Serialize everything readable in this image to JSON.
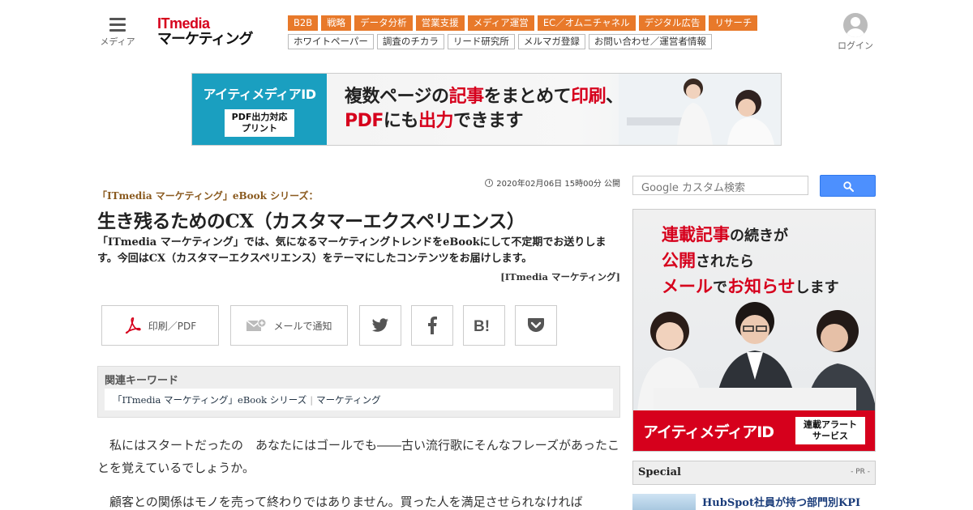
{
  "header": {
    "menu_label": "メディア",
    "logo_top": "ITmedia",
    "logo_bottom": "マーケティング",
    "nav_primary": [
      "B2B",
      "戦略",
      "データ分析",
      "営業支援",
      "メディア運営",
      "EC／オムニチャネル",
      "デジタル広告",
      "リサーチ"
    ],
    "nav_secondary": [
      "ホワイトペーパー",
      "調査のチカラ",
      "リード研究所",
      "メルマガ登録",
      "お問い合わせ／運営者情報"
    ],
    "login_label": "ログイン"
  },
  "banner": {
    "brand": "アイティメディアID",
    "badge_line1": "PDF出力対応",
    "badge_line2": "プリント",
    "line1_a": "複数ページの",
    "line1_b": "記事",
    "line1_c": "をまとめて",
    "line1_d": "印刷",
    "line1_e": "、",
    "line2_a": "PDF",
    "line2_b": "にも",
    "line2_c": "出力",
    "line2_d": "できます"
  },
  "article": {
    "date": "2020年02月06日 15時00分 公開",
    "series": "「ITmedia マーケティング」eBook シリーズ：",
    "title": "生き残るためのCX（カスタマーエクスペリエンス）",
    "lead": "「ITmedia マーケティング」では、気になるマーケティングトレンドをeBookにして不定期でお送りします。今回はCX（カスタマーエクスペリエンス）をテーマにしたコンテンツをお届けします。",
    "byline": "[ITmedia マーケティング]",
    "share_print": "印刷／PDF",
    "share_mail": "メールで通知",
    "keywords_title": "関連キーワード",
    "keywords": [
      "「ITmedia マーケティング」eBook シリーズ",
      "マーケティング"
    ],
    "paragraph1": "私にはスタートだったの　あなたにはゴールでも――古い流行歌にそんなフレーズがあったことを覚えているでしょうか。",
    "paragraph2": "顧客との関係はモノを売って終わりではありません。買った人を満足させられなければ"
  },
  "sidebar": {
    "search_placeholder": "Google カスタム検索",
    "ad_line1_a": "連載記事",
    "ad_line1_b": "の続きが",
    "ad_line2_a": "公開",
    "ad_line2_b": "されたら",
    "ad_line3_a": "メール",
    "ad_line3_b": "で",
    "ad_line3_c": "お知らせ",
    "ad_line3_d": "します",
    "ad_brand": "アイティメディアID",
    "ad_badge_line1": "連載アラート",
    "ad_badge_line2": "サービス",
    "special_title": "Special",
    "special_pr": "- PR -",
    "special_item": "HubSpot社員が持つ部門別KPI"
  },
  "colors": {
    "accent_orange": "#e8792a",
    "brand_red": "#d6001c",
    "banner_blue": "#1a9fc0",
    "search_blue": "#4d90fe"
  }
}
